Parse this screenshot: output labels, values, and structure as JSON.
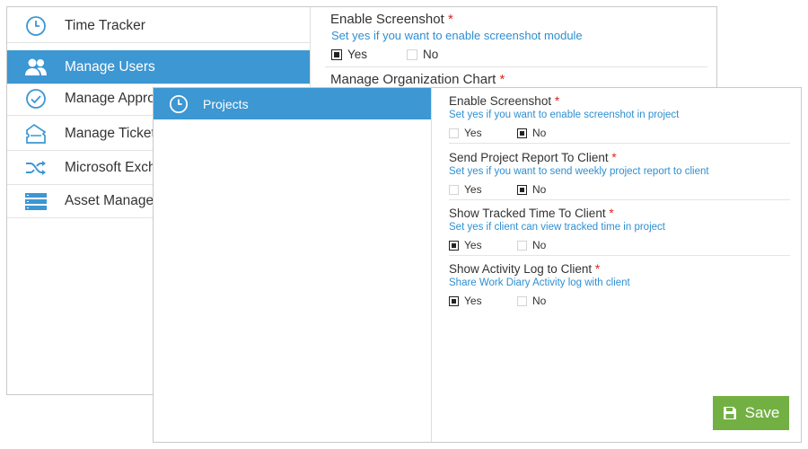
{
  "back_window": {
    "sidebar": {
      "items": [
        {
          "label": "Time Tracker",
          "icon": "clock-icon",
          "active": false
        },
        {
          "label": "Manage Users",
          "icon": "users-icon",
          "active": true
        },
        {
          "label": "Manage Approvals",
          "icon": "check-circle-icon",
          "active": false
        },
        {
          "label": "Manage Tickets",
          "icon": "ticket-icon",
          "active": false
        },
        {
          "label": "Microsoft Exchange",
          "icon": "shuffle-icon",
          "active": false
        },
        {
          "label": "Asset Management",
          "icon": "list-icon",
          "active": false
        }
      ]
    },
    "settings": [
      {
        "title": "Enable Screenshot",
        "required": "*",
        "description": "Set yes if you want to enable screenshot module",
        "yes_label": "Yes",
        "no_label": "No",
        "value": "Yes"
      },
      {
        "title": "Manage Organization Chart",
        "required": "*"
      }
    ]
  },
  "front_window": {
    "sidebar": {
      "active_item": {
        "label": "Projects",
        "icon": "clock-icon"
      }
    },
    "settings": [
      {
        "title": "Enable Screenshot",
        "required": "*",
        "description": "Set yes if you want to enable screenshot in project",
        "yes_label": "Yes",
        "no_label": "No",
        "value": "No"
      },
      {
        "title": "Send Project Report To Client",
        "required": "*",
        "description": "Set yes if you want to send weekly project report to client",
        "yes_label": "Yes",
        "no_label": "No",
        "value": "No"
      },
      {
        "title": "Show Tracked Time To Client",
        "required": "*",
        "description": "Set yes if client can view tracked time in project",
        "yes_label": "Yes",
        "no_label": "No",
        "value": "Yes"
      },
      {
        "title": "Show Activity Log to Client",
        "required": "*",
        "description": "Share Work Diary Activity log with client",
        "yes_label": "Yes",
        "no_label": "No",
        "value": "Yes"
      }
    ],
    "save_button": {
      "label": "Save",
      "icon": "floppy-disk-icon"
    }
  },
  "colors": {
    "accent": "#3c97d3",
    "description_text": "#2e8fd1",
    "required": "#d9261c",
    "save_button": "#72b043"
  }
}
